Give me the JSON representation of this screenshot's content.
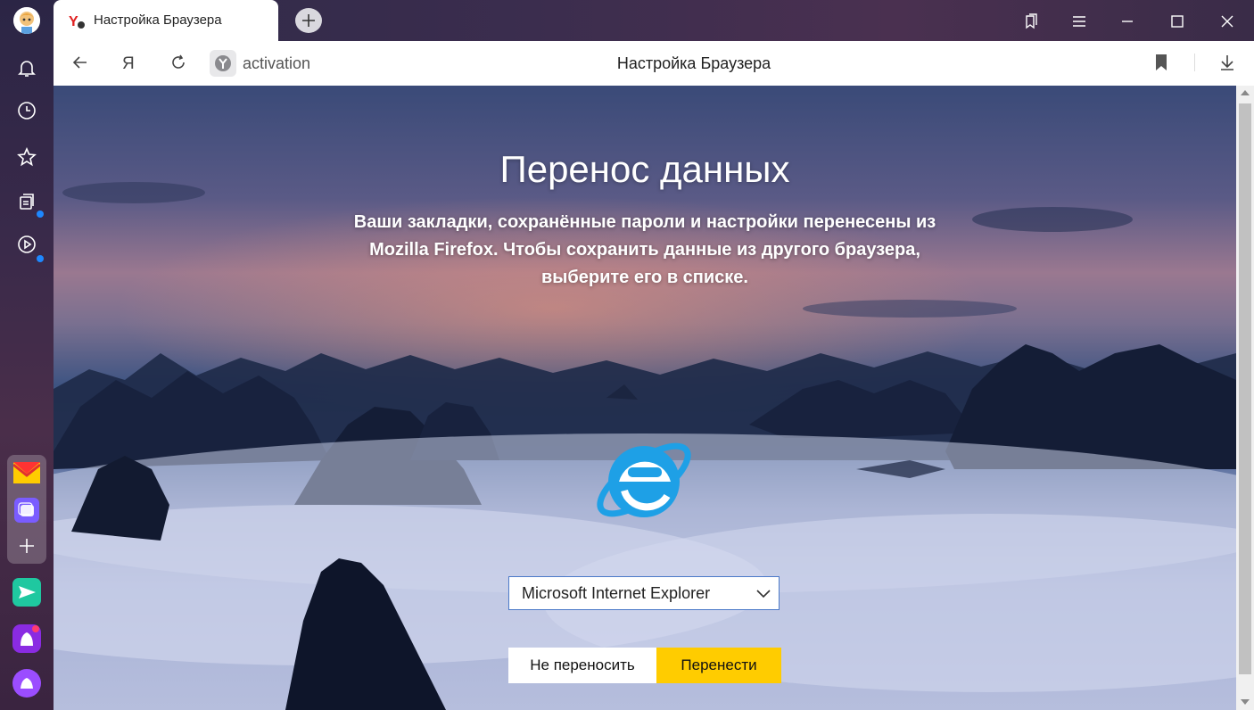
{
  "tab": {
    "title": "Настройка Браузера"
  },
  "address": {
    "host": "activation",
    "page_title": "Настройка Браузера"
  },
  "main": {
    "heading": "Перенос данных",
    "description": "Ваши закладки, сохранённые пароли и настройки перенесены из Mozilla Firefox. Чтобы сохранить данные из другого браузера, выберите его в списке.",
    "browser_select": {
      "selected": "Microsoft Internet Explorer"
    },
    "skip_label": "Не переносить",
    "transfer_label": "Перенести"
  },
  "icons": {
    "sidebar": [
      "avatar",
      "bell-icon",
      "clock-icon",
      "star-icon",
      "collections-icon",
      "play-icon",
      "mail-icon",
      "messenger-icon",
      "add-icon",
      "send-icon",
      "alice-app-icon",
      "alice-icon"
    ],
    "toolbar": [
      "back-icon",
      "yandex-icon",
      "reload-icon",
      "site-icon",
      "bookmark-icon",
      "download-icon"
    ],
    "window": [
      "bookmarks-panel-icon",
      "menu-icon",
      "minimize-icon",
      "maximize-icon",
      "close-icon"
    ],
    "main": "internet-explorer-logo"
  },
  "colors": {
    "accent": "#ffcc00",
    "ie_blue": "#1ea0e6",
    "notify_dot": "#1e88ff"
  }
}
